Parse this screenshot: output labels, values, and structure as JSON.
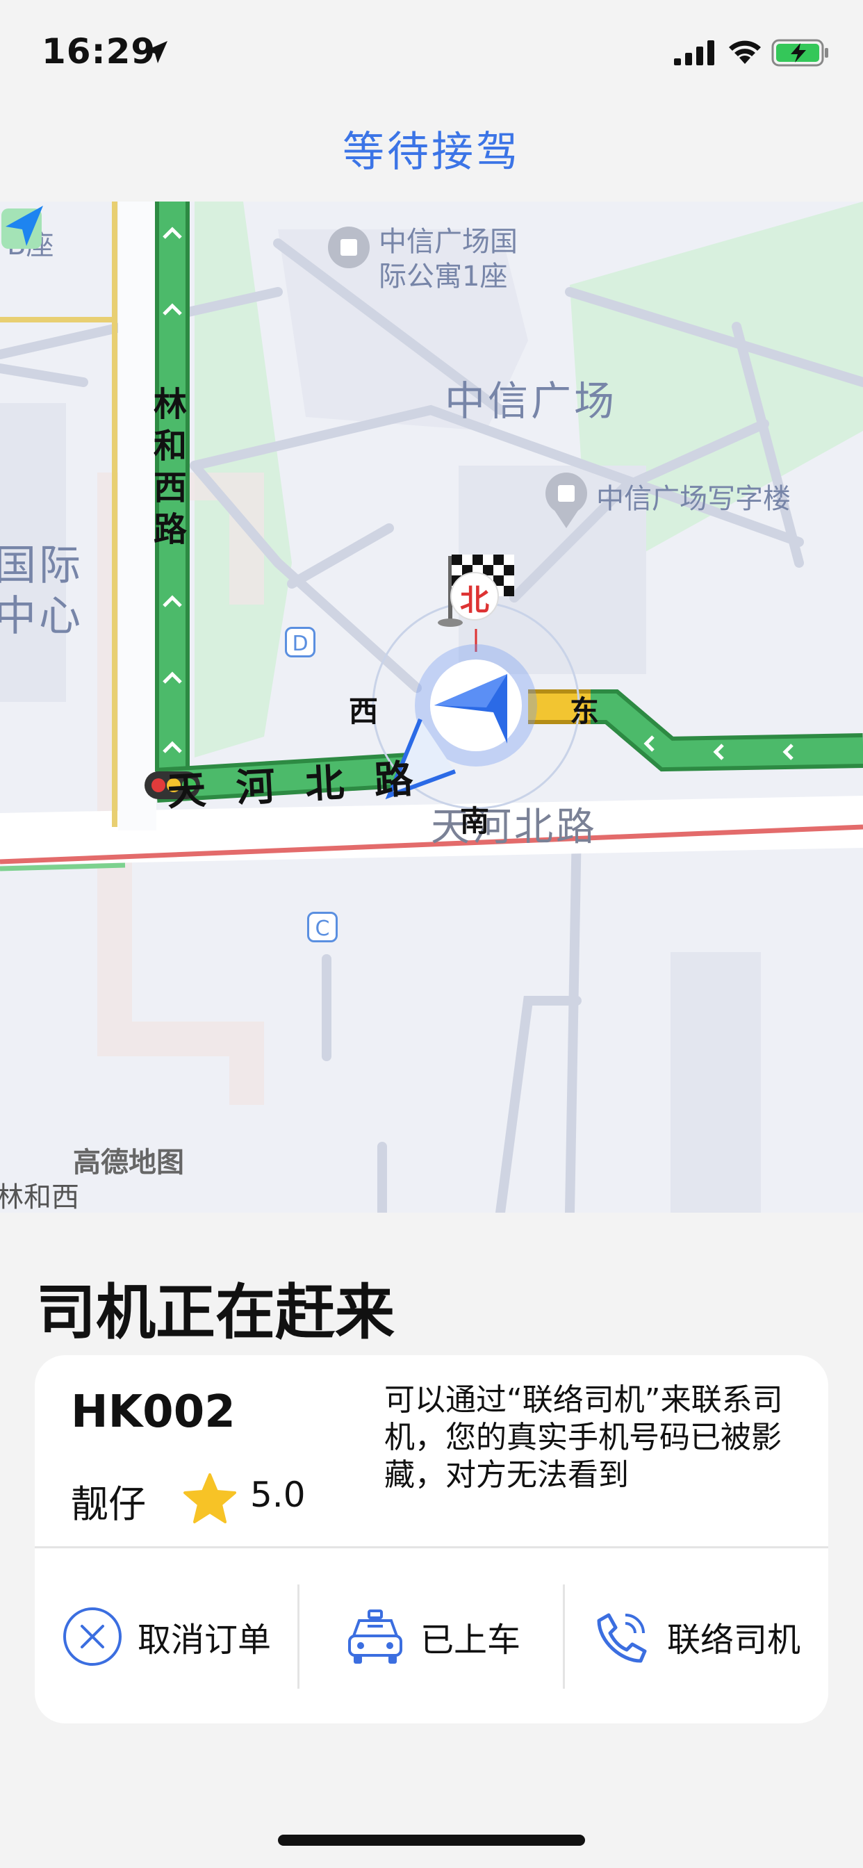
{
  "status_bar": {
    "time": "16:29"
  },
  "nav": {
    "title": "等待接驾"
  },
  "map": {
    "labels": {
      "b_zuo": "B座",
      "poi_apartment_1": "中信广场国",
      "poi_apartment_2": "际公寓1座",
      "zhongxin": "中信广场",
      "office": "中信广场写字楼",
      "guoji_1": "国际",
      "guoji_2": "中心",
      "linhe_west_road": [
        "林",
        "和",
        "西",
        "路"
      ],
      "tianhe_north_road": "天 河 北 路",
      "tianhe_north_road_2": "天河北路",
      "linhe_xi_bottom": "林和西",
      "poi_d": "D",
      "poi_c": "C",
      "amap": "高德地图"
    },
    "compass": {
      "north": "北",
      "south": "南",
      "east": "东",
      "west": "西"
    }
  },
  "main": {
    "title": "司机正在赶来",
    "card": {
      "plate": "HK002",
      "driver_name": "靓仔",
      "rating": "5.0",
      "notice": "可以通过“联络司机”来联系司机，您的真实手机号码已被影藏，对方无法看到",
      "actions": {
        "cancel": "取消订单",
        "boarded": "已上车",
        "contact": "联络司机"
      }
    }
  },
  "colors": {
    "accent": "#3b74e6",
    "route_green": "#4cba6a",
    "route_yellow": "#f2c531"
  }
}
